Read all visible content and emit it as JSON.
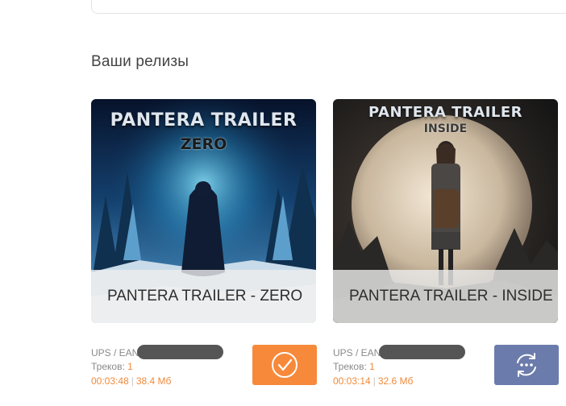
{
  "page": {
    "section_title": "Ваши релизы"
  },
  "colors": {
    "accent_orange": "#f7893a",
    "processing_blue": "#6b7bab",
    "meta_orange": "#f08a3c"
  },
  "releases": [
    {
      "title": "PANTERA TRAILER - ZERO",
      "cover_brand": "PANTERA TRAILER",
      "cover_subtitle": "ZERO",
      "upc_label": "UPS / EAN",
      "tracks_label": "Треков:",
      "tracks": "1",
      "duration": "00:03:48",
      "size": "38.4 Мб",
      "status_icon": "check-circle-icon"
    },
    {
      "title": "PANTERA TRAILER - INSIDE",
      "cover_brand": "PANTERA TRAILER",
      "cover_subtitle": "INSIDE",
      "upc_label": "UPS / EAN",
      "tracks_label": "Треков:",
      "tracks": "1",
      "duration": "00:03:14",
      "size": "32.6 Мб",
      "status_icon": "sync-dots-icon"
    }
  ]
}
